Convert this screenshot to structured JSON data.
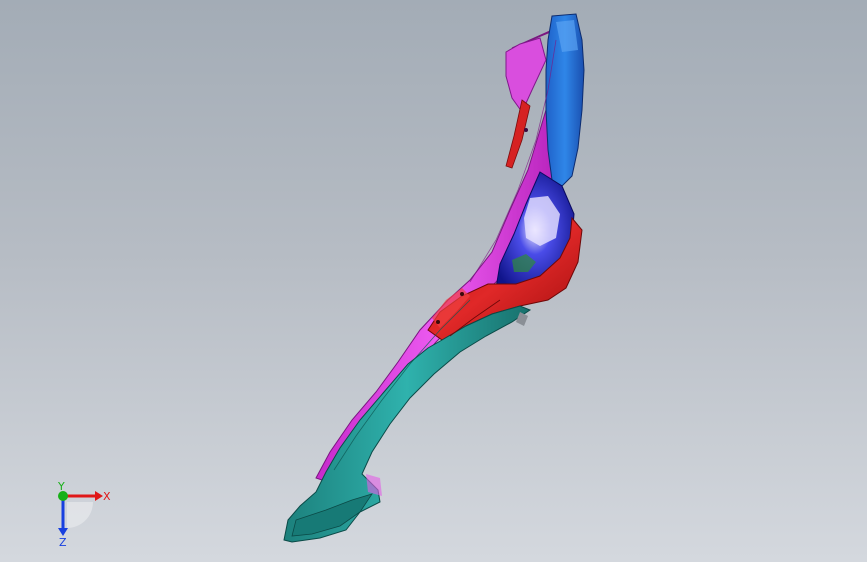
{
  "viewport": {
    "background_top": "#a3acb6",
    "background_bottom": "#d4d8de"
  },
  "model": {
    "part_colors": {
      "upper_block": "#2a7ee0",
      "main_body": "#e23ce8",
      "lower_body": "#24a39e",
      "mid_band": "#d41c1c",
      "inner_cavity": "#1a20c8"
    }
  },
  "triad": {
    "x_label": "X",
    "y_label": "Y",
    "z_label": "Z",
    "colors": {
      "x": "#e01818",
      "y": "#18b018",
      "z": "#1840e0"
    }
  }
}
